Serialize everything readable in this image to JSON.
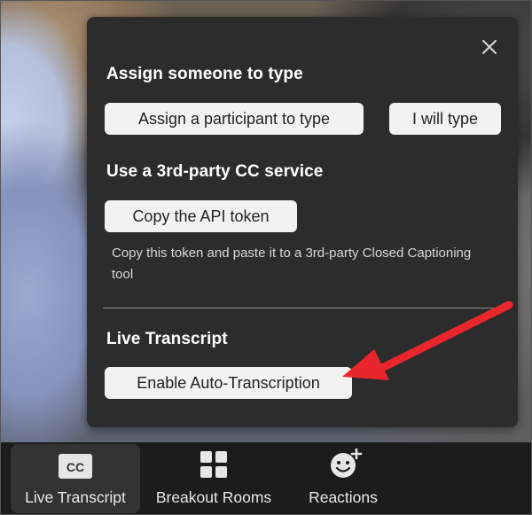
{
  "dialog": {
    "close_icon": "close-icon",
    "section_assign": {
      "title": "Assign someone to type",
      "assign_participant_label": "Assign a participant to type",
      "i_will_type_label": "I will type"
    },
    "section_third_party": {
      "title": "Use a 3rd-party CC service",
      "copy_token_label": "Copy the API token",
      "description": "Copy this token and paste it to a 3rd-party Closed Captioning tool"
    },
    "section_live_transcript": {
      "title": "Live Transcript",
      "enable_label": "Enable Auto-Transcription"
    }
  },
  "toolbar": {
    "items": [
      {
        "label": "Live Transcript",
        "icon": "cc-icon",
        "active": true
      },
      {
        "label": "Breakout Rooms",
        "icon": "grid-icon",
        "active": false
      },
      {
        "label": "Reactions",
        "icon": "smiley-plus-icon",
        "active": false
      }
    ],
    "cc_badge": "CC"
  },
  "colors": {
    "panel_bg": "#2c2c2c",
    "button_bg": "#f2f2f2",
    "annotation_arrow": "#e8262c"
  }
}
